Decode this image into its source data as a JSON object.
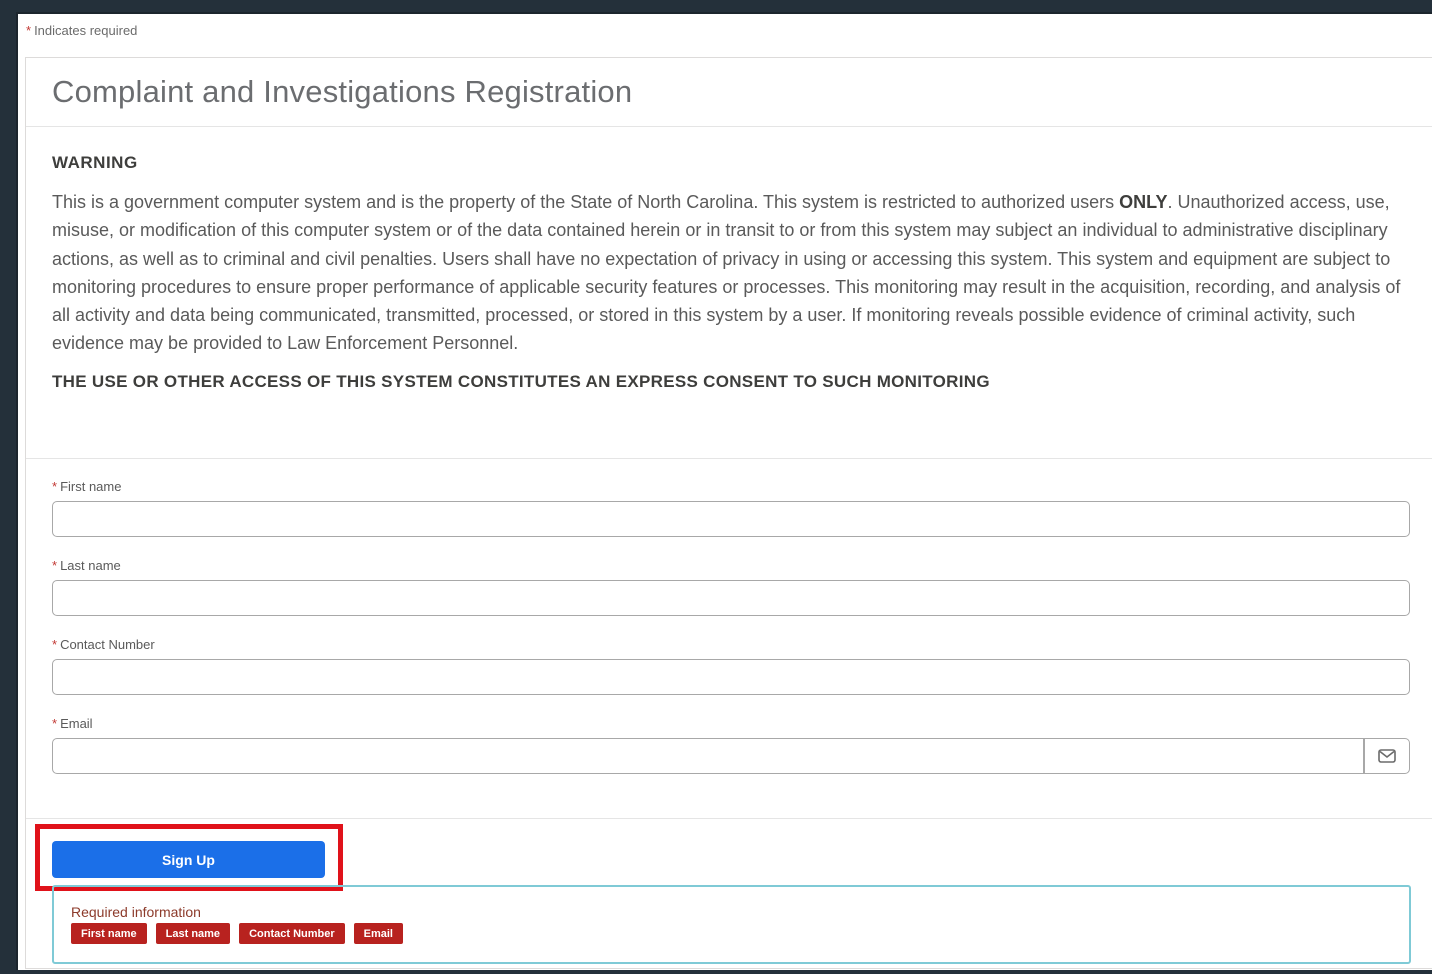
{
  "required_note": {
    "star": "*",
    "text": "Indicates required"
  },
  "card": {
    "title": "Complaint and Investigations Registration"
  },
  "warning": {
    "heading": "WARNING",
    "body_part1": "This is a government computer system and is the property of the State of North Carolina. This system is restricted to authorized users ",
    "body_emphasis": "ONLY",
    "body_part2": ". Unauthorized access, use, misuse, or modification of this computer system or of the data contained herein or in transit to or from this system may subject an individual to administrative disciplinary actions, as well as to criminal and civil penalties. Users shall have no expectation of privacy in using or accessing this system. This system and equipment are subject to monitoring procedures to ensure proper performance of applicable security features or processes. This monitoring may result in the acquisition, recording, and analysis of all activity and data being communicated, transmitted, processed, or stored in this system by a user. If monitoring reveals possible evidence of criminal activity, such evidence may be provided to Law Enforcement Personnel.",
    "consent": "THE USE OR OTHER ACCESS OF THIS SYSTEM CONSTITUTES AN EXPRESS CONSENT TO SUCH MONITORING"
  },
  "form": {
    "star": "*",
    "first_name": {
      "label": "First name",
      "value": ""
    },
    "last_name": {
      "label": "Last name",
      "value": ""
    },
    "contact_number": {
      "label": "Contact Number",
      "value": ""
    },
    "email": {
      "label": "Email",
      "value": "",
      "icon": "mail-icon"
    }
  },
  "actions": {
    "signup_label": "Sign Up"
  },
  "required_info": {
    "title": "Required information",
    "chips": [
      "First name",
      "Last name",
      "Contact Number",
      "Email"
    ]
  },
  "colors": {
    "primary_button": "#1b6fe8",
    "highlight": "#e0121a",
    "chip": "#b8221f",
    "required_star": "#c23934"
  }
}
